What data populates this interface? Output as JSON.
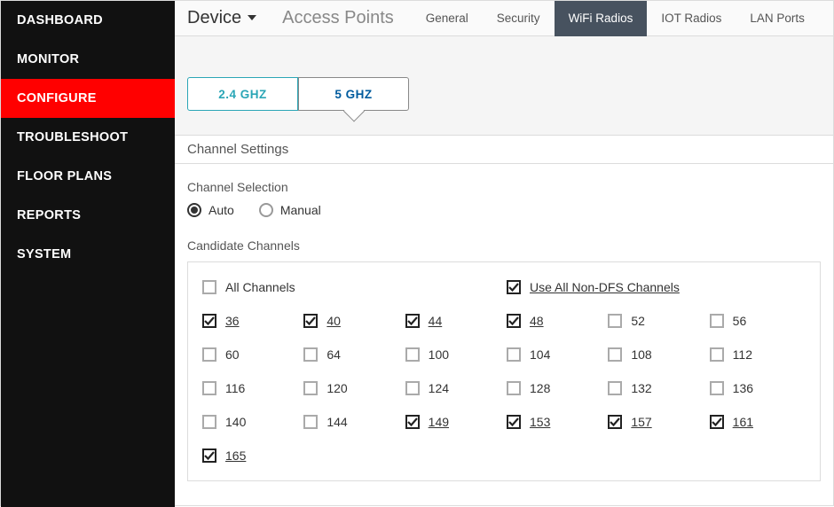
{
  "sidebar": {
    "items": [
      "DASHBOARD",
      "MONITOR",
      "CONFIGURE",
      "TROUBLESHOOT",
      "FLOOR PLANS",
      "REPORTS",
      "SYSTEM"
    ],
    "active_index": 2
  },
  "header": {
    "device_label": "Device",
    "page_title": "Access Points",
    "tabs": [
      "General",
      "Security",
      "WiFi Radios",
      "IOT Radios",
      "LAN Ports"
    ],
    "active_tab_index": 2
  },
  "freq": {
    "options": [
      "2.4 GHZ",
      "5 GHZ"
    ],
    "active_index": 1
  },
  "section_heading": "Channel Settings",
  "channel_selection": {
    "label": "Channel Selection",
    "options": [
      "Auto",
      "Manual"
    ],
    "selected_index": 0
  },
  "candidate": {
    "label": "Candidate Channels",
    "all_channels": {
      "label": "All Channels",
      "checked": false
    },
    "non_dfs": {
      "label": "Use All Non-DFS Channels",
      "checked": true
    },
    "channels": [
      {
        "n": "36",
        "checked": true
      },
      {
        "n": "40",
        "checked": true
      },
      {
        "n": "44",
        "checked": true
      },
      {
        "n": "48",
        "checked": true
      },
      {
        "n": "52",
        "checked": false
      },
      {
        "n": "56",
        "checked": false
      },
      {
        "n": "60",
        "checked": false
      },
      {
        "n": "64",
        "checked": false
      },
      {
        "n": "100",
        "checked": false
      },
      {
        "n": "104",
        "checked": false
      },
      {
        "n": "108",
        "checked": false
      },
      {
        "n": "112",
        "checked": false
      },
      {
        "n": "116",
        "checked": false
      },
      {
        "n": "120",
        "checked": false
      },
      {
        "n": "124",
        "checked": false
      },
      {
        "n": "128",
        "checked": false
      },
      {
        "n": "132",
        "checked": false
      },
      {
        "n": "136",
        "checked": false
      },
      {
        "n": "140",
        "checked": false
      },
      {
        "n": "144",
        "checked": false
      },
      {
        "n": "149",
        "checked": true
      },
      {
        "n": "153",
        "checked": true
      },
      {
        "n": "157",
        "checked": true
      },
      {
        "n": "161",
        "checked": true
      },
      {
        "n": "165",
        "checked": true
      }
    ]
  }
}
